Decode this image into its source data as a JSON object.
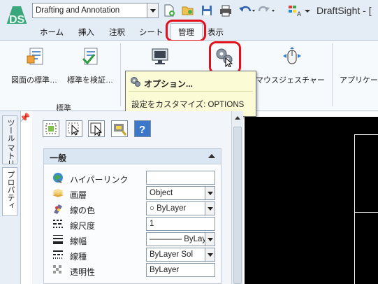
{
  "app": {
    "title": "DraftSight - ["
  },
  "workspace": {
    "selected": "Drafting and Annotation"
  },
  "quick_access": [
    "new-icon",
    "open-icon",
    "save-icon",
    "print-icon",
    "undo-icon",
    "redo-icon",
    "customize-icon"
  ],
  "tabs": [
    {
      "label": "ホーム"
    },
    {
      "label": "挿入"
    },
    {
      "label": "注釈"
    },
    {
      "label": "シート"
    },
    {
      "label": "管理"
    },
    {
      "label": "表示"
    }
  ],
  "ribbon": {
    "standards_button": "図面の標準…",
    "check_button": "標準を検証…",
    "panel_label": "標準",
    "mouse_gesture_button": "マウスジェスチャー",
    "applications_button": "アプリケー"
  },
  "tooltip": {
    "title": "オプション...",
    "description": "設定をカスタマイズ: OPTIONS"
  },
  "side_tabs": {
    "tool_matrix": "ツール マトリックス",
    "properties": "プロパティ"
  },
  "properties": {
    "group_title": "一般",
    "rows": [
      {
        "label": "ハイパーリンク",
        "value": ""
      },
      {
        "label": "画層",
        "value": "Object"
      },
      {
        "label": "線の色",
        "value": "○ ByLayer"
      },
      {
        "label": "線尺度",
        "value": "1"
      },
      {
        "label": "線幅",
        "value": "―――― ByLayer"
      },
      {
        "label": "線種",
        "value": "ByLayer       Sol"
      },
      {
        "label": "透明性",
        "value": "ByLayer"
      }
    ]
  },
  "colors": {
    "highlight": "#e2101a",
    "tooltip_bg": "#fbfbd6",
    "canvas": "#000000"
  }
}
